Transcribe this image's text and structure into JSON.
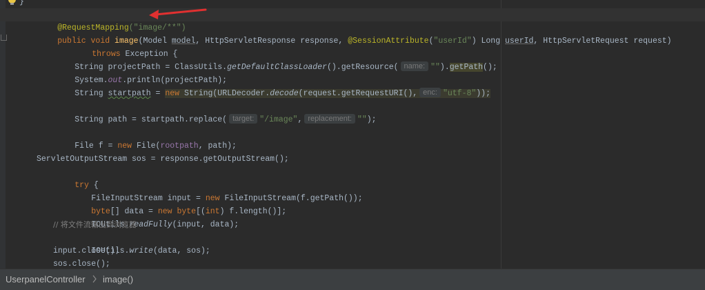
{
  "editor": {
    "lines": {
      "l0": "}",
      "l1_ann": "@RequestMapping",
      "l1_str": "(\"image/**\")",
      "l2_public": "public void ",
      "l2_name": "image",
      "l2_a": "(Model ",
      "l2_model": "model",
      "l2_b": ", HttpServletResponse response, ",
      "l2_ann": "@SessionAttribute",
      "l2_c": "(",
      "l2_str": "\"userId\"",
      "l2_d": ") Long ",
      "l2_userid": "userId",
      "l2_e": ", HttpServletRequest request)",
      "l3_throws": "throws",
      "l3_rest": " Exception {",
      "l4_a": "String projectPath = ClassUtils.",
      "l4_fn": "getDefaultClassLoader",
      "l4_b": "().getResource(",
      "l4_hint": "name:",
      "l4_str": "\"\"",
      "l4_c": ").",
      "l4_getpath": "getPath",
      "l4_d": "();",
      "l5_a": "System.",
      "l5_out": "out",
      "l5_b": ".println(projectPath);",
      "l6_a": "String ",
      "l6_var": "startpath",
      "l6_b": " = ",
      "l6_new": "new ",
      "l6_c": "String(URLDecoder.",
      "l6_fn": "decode",
      "l6_d": "(request.getRequestURI(),",
      "l6_hint": "enc:",
      "l6_str": "\"utf-8\"",
      "l6_e": "));",
      "l8_a": "String path = startpath.replace(",
      "l8_hint1": "target:",
      "l8_str1": "\"/image\"",
      "l8_comma": ",",
      "l8_hint2": "replacement:",
      "l8_str2": "\"\"",
      "l8_b": ");",
      "l10_a": "File f = ",
      "l10_new": "new ",
      "l10_b": "File(",
      "l10_fld": "rootpath",
      "l10_c": ", path);",
      "l12": "ServletOutputStream sos = response.getOutputStream();",
      "l13_try": "try",
      "l13_b": " {",
      "l14_a": "FileInputStream input = ",
      "l14_new": "new ",
      "l14_b": "FileInputStream(f.getPath());",
      "l15_byte": "byte",
      "l15_a": "[] data = ",
      "l15_new": "new ",
      "l15_byte2": "byte",
      "l15_b": "[(",
      "l15_int": "int",
      "l15_c": ") f.length()];",
      "l16_a": "IOUtils.",
      "l16_fn": "readFully",
      "l16_b": "(input, data);",
      "l17": "// 将文件流输出到浏览器",
      "l18_a": "IOUtils.",
      "l18_fn": "write",
      "l18_b": "(data, sos);",
      "l19": "input.close();",
      "l20": "sos.close();"
    }
  },
  "breadcrumb": {
    "class_name": "UserpanelController",
    "method_name": "image()"
  },
  "colors": {
    "background": "#2b2b2b",
    "keyword": "#cc7832",
    "annotation": "#bbb529",
    "string": "#6a8759",
    "field": "#9876aa",
    "arrow": "#e03030"
  },
  "icons": [
    "lightbulb-icon",
    "red-arrow-annotation",
    "chevron-right-icon",
    "fold-marker-icon"
  ]
}
